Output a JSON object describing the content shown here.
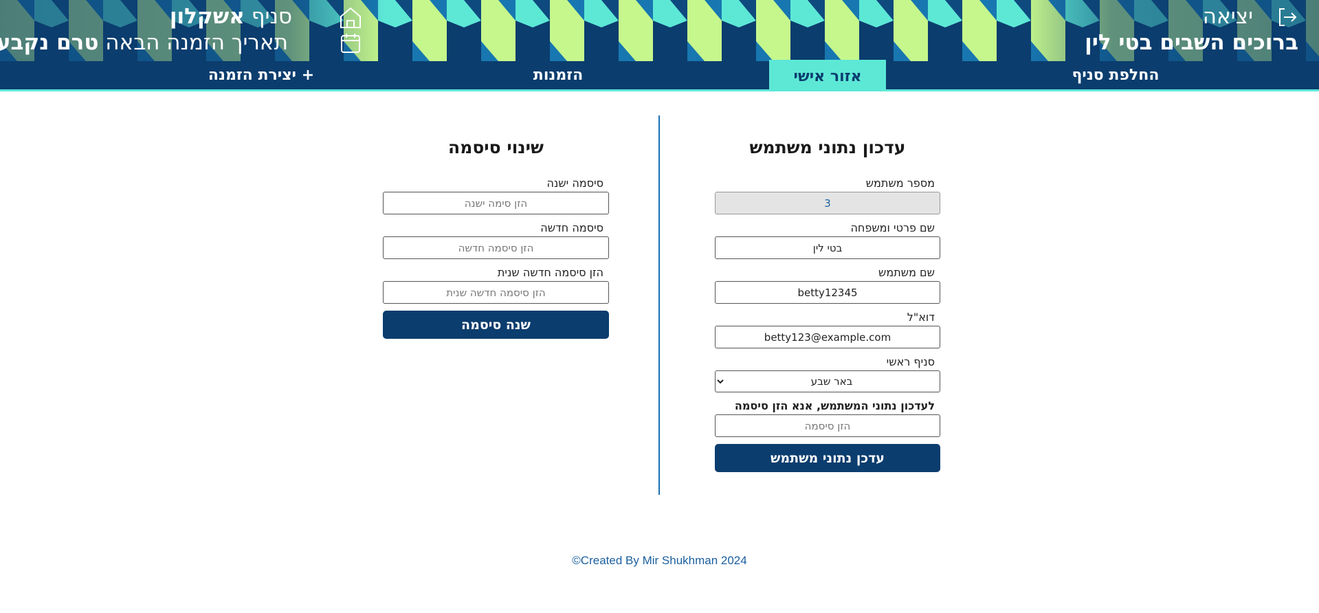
{
  "header": {
    "logout_label": "יציאה",
    "welcome_text": "ברוכים השבים בטי לין",
    "branch_prefix": "סניף",
    "branch_name": "אשקלון",
    "next_order_prefix": "תאריך הזמנה הבאה",
    "next_order_value": "טרם נקבע",
    "icons": {
      "logout": "logout-icon",
      "home": "home-icon",
      "calendar": "calendar-icon"
    }
  },
  "nav": {
    "switch_branch": "החלפת סניף",
    "personal_area": "אזור אישי",
    "orders": "הזמנות",
    "create_order": "+ יצירת הזמנה"
  },
  "update_form": {
    "title": "עדכון נתוני משתמש",
    "user_id_label": "מספר משתמש",
    "user_id_value": "3",
    "fullname_label": "שם פרטי ומשפחה",
    "fullname_value": "בטי לין",
    "username_label": "שם משתמש",
    "username_value": "betty12345",
    "email_label": "דוא\"ל",
    "email_value": "betty123@example.com",
    "main_branch_label": "סניף ראשי",
    "main_branch_value": "באר שבע",
    "password_prompt": "לעדכון נתוני המשתמש, אנא הזן סיסמה",
    "password_placeholder": "הזן סיסמה",
    "submit_label": "עדכן נתוני משתמש"
  },
  "password_form": {
    "title": "שינוי סיסמה",
    "old_label": "סיסמה ישנה",
    "old_placeholder": "הזן סימה ישנה",
    "new_label": "סיסמה חדשה",
    "new_placeholder": "הזן סיסמה חדשה",
    "repeat_label": "הזן סיסמה חדשה שנית",
    "repeat_placeholder": "הזן סיסמה חדשה שנית",
    "submit_label": "שנה סיסמה"
  },
  "footer": {
    "text": "©Created By Mir Shukhman 2024"
  },
  "colors": {
    "primary": "#0b3d6e",
    "accent": "#5de8d6",
    "pattern_lime": "#c6f78c",
    "pattern_blue": "#1877b0",
    "divider": "#1a6fb5"
  }
}
